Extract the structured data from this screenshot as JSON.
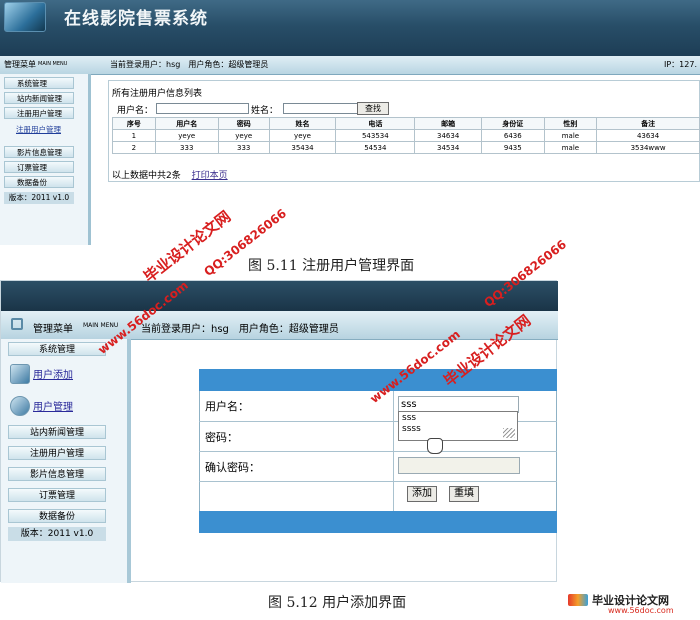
{
  "fig1": {
    "system_title": "在线影院售票系统",
    "menu_title": "管理菜单",
    "menu_subtitle": "MAIN MENU",
    "current_user": "当前登录用户：hsg　用户角色：超级管理员",
    "ip": "IP：127.",
    "sidebar": [
      "系统管理",
      "站内新闻管理",
      "注册用户管理",
      "注册用户管理",
      "影片信息管理",
      "订票管理",
      "数据备份"
    ],
    "version": "版本：2011 v1.0",
    "list_title": "所有注册用户信息列表",
    "search": {
      "username_label": "用户名：",
      "name_label": "姓名：",
      "search_button": "查找"
    },
    "table": {
      "headers": [
        "序号",
        "用户名",
        "密码",
        "姓名",
        "电话",
        "邮箱",
        "身份证",
        "性别",
        "备注"
      ],
      "rows": [
        [
          "1",
          "yeye",
          "yeye",
          "yeye",
          "543534",
          "34634",
          "6436",
          "male",
          "43634"
        ],
        [
          "2",
          "333",
          "333",
          "35434",
          "54534",
          "34534",
          "9435",
          "male",
          "3534www"
        ]
      ]
    },
    "summary": "以上数据中共2条",
    "print_link": "打印本页",
    "caption": "图 5.11 注册用户管理界面"
  },
  "fig2": {
    "menu_title": "管理菜单",
    "menu_subtitle": "MAIN MENU",
    "current_user": "当前登录用户：hsg　用户角色：超级管理员",
    "sidebar_top": [
      "系统管理"
    ],
    "link_add_user": "用户添加",
    "link_manage_user": "用户管理",
    "sidebar": [
      "站内新闻管理",
      "注册用户管理",
      "影片信息管理",
      "订票管理",
      "数据备份"
    ],
    "version": "版本：2011 v1.0",
    "form": {
      "username_label": "用户名：",
      "username_value": "sss",
      "password_label": "密码：",
      "confirm_label": "确认密码：",
      "autocomplete": [
        "sss",
        "ssss"
      ],
      "add_button": "添加",
      "reset_button": "重填"
    },
    "caption": "图 5.12 用户添加界面"
  },
  "watermarks": {
    "site_cn": "毕业设计论文网",
    "qq": "QQ:306826066",
    "site_url": "www.56doc.com"
  },
  "brand": {
    "name": "毕业设计论文网",
    "url": "www.56doc.com"
  },
  "colors": {
    "header_dark": "#1d3d55",
    "form_blue": "#3b8fd0",
    "watermark_red": "#d81f1f"
  }
}
